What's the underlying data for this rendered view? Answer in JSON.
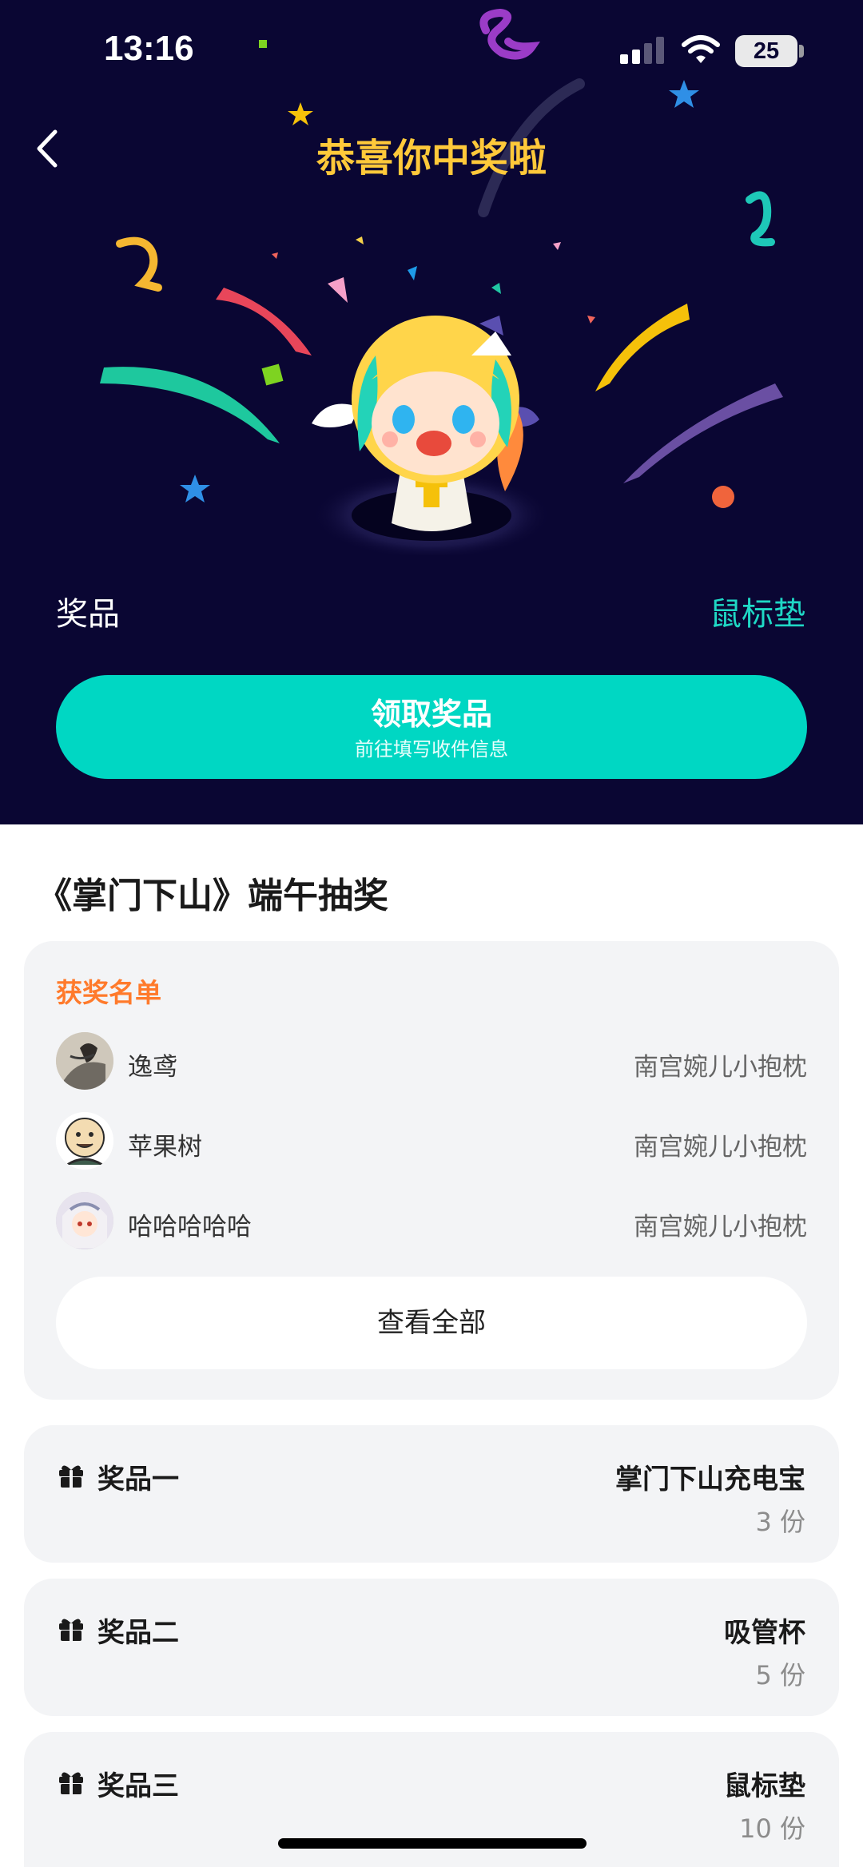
{
  "status_bar": {
    "time": "13:16",
    "battery": "25"
  },
  "header": {
    "title": "恭喜你中奖啦"
  },
  "prize_summary": {
    "label": "奖品",
    "value": "鼠标垫"
  },
  "claim_button": {
    "title": "领取奖品",
    "subtitle": "前往填写收件信息"
  },
  "lottery": {
    "title": "《掌门下山》端午抽奖"
  },
  "winners": {
    "heading": "获奖名单",
    "rows": [
      {
        "name": "逸鸢",
        "prize": "南宫婉儿小抱枕"
      },
      {
        "name": "苹果树",
        "prize": "南宫婉儿小抱枕"
      },
      {
        "name": "哈哈哈哈哈",
        "prize": "南宫婉儿小抱枕"
      }
    ],
    "view_all": "查看全部"
  },
  "prizes": [
    {
      "label": "奖品一",
      "item": "掌门下山充电宝",
      "qty": "3 份"
    },
    {
      "label": "奖品二",
      "item": "吸管杯",
      "qty": "5 份"
    },
    {
      "label": "奖品三",
      "item": "鼠标垫",
      "qty": "10 份"
    }
  ],
  "colors": {
    "hero_bg": "#0a0633",
    "title_gold": "#ffc93a",
    "accent_teal": "#00d7c3",
    "winners_orange": "#ff7a2b"
  },
  "icons": [
    "back-chevron-icon",
    "signal-icon",
    "wifi-icon",
    "battery-icon",
    "gift-icon"
  ]
}
